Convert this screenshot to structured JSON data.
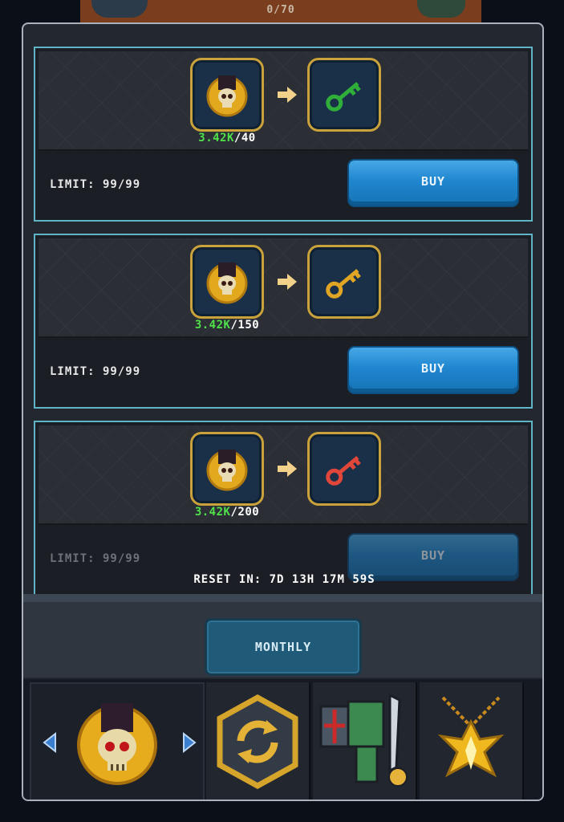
{
  "header": {
    "counter": "0/70"
  },
  "offers": [
    {
      "have": "3.42K",
      "cost": "/40",
      "output_icon": "green-key-icon",
      "key_color": "#2fae3a",
      "limit": "LIMIT: 99/99",
      "buy_label": "BUY"
    },
    {
      "have": "3.42K",
      "cost": "/150",
      "output_icon": "gold-key-icon",
      "key_color": "#e0a525",
      "limit": "LIMIT: 99/99",
      "buy_label": "BUY"
    },
    {
      "have": "3.42K",
      "cost": "/200",
      "output_icon": "red-key-icon",
      "key_color": "#e0463a",
      "limit": "LIMIT: 99/99",
      "buy_label": "BUY"
    }
  ],
  "reset": {
    "text": "RESET IN:  7D 13H 17M 59S"
  },
  "tabs": {
    "monthly_label": "MONTHLY"
  },
  "currency_strip": {
    "items": [
      "skull-coin-icon",
      "exchange-icon",
      "armor-set-icon",
      "pendant-icon"
    ]
  },
  "colors": {
    "accent_border": "#5fb5c5",
    "buy": "#1f86cf",
    "have": "#4fe04a",
    "slot_border": "#c9a23c"
  }
}
